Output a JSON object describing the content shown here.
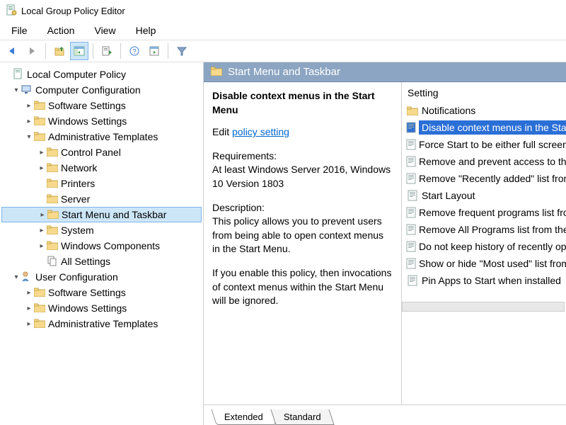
{
  "titlebar": {
    "title": "Local Group Policy Editor"
  },
  "menu": {
    "file": "File",
    "action": "Action",
    "view": "View",
    "help": "Help"
  },
  "tree": {
    "root": "Local Computer Policy",
    "cc": "Computer Configuration",
    "cc_sw": "Software Settings",
    "cc_win": "Windows Settings",
    "cc_admin": "Administrative Templates",
    "cc_cp": "Control Panel",
    "cc_net": "Network",
    "cc_prn": "Printers",
    "cc_srv": "Server",
    "cc_start": "Start Menu and Taskbar",
    "cc_sys": "System",
    "cc_wc": "Windows Components",
    "cc_all": "All Settings",
    "uc": "User Configuration",
    "uc_sw": "Software Settings",
    "uc_win": "Windows Settings",
    "uc_admin": "Administrative Templates"
  },
  "detail": {
    "header": "Start Menu and Taskbar",
    "policy_title": "Disable context menus in the Start Menu",
    "edit_prefix": "Edit ",
    "edit_link": "policy setting",
    "req_label": "Requirements:",
    "req_text": "At least Windows Server 2016, Windows 10 Version 1803",
    "desc_label": "Description:",
    "desc_text": "This policy allows you to prevent users from being able to open context menus in the Start Menu.",
    "desc_text2": "If you enable this policy, then invocations of context menus within the Start Menu will be ignored."
  },
  "list": {
    "column": "Setting",
    "items": [
      {
        "kind": "folder",
        "label": "Notifications"
      },
      {
        "kind": "policy",
        "label": "Disable context menus in the Start Menu",
        "selected": true
      },
      {
        "kind": "policy",
        "label": "Force Start to be either full screen or menu"
      },
      {
        "kind": "policy",
        "label": "Remove and prevent access to the Shut Down command"
      },
      {
        "kind": "policy",
        "label": "Remove \"Recently added\" list from Start Menu"
      },
      {
        "kind": "policy",
        "label": "Start Layout"
      },
      {
        "kind": "policy",
        "label": "Remove frequent programs list from the Start Menu"
      },
      {
        "kind": "policy",
        "label": "Remove All Programs list from the Start Menu"
      },
      {
        "kind": "policy",
        "label": "Do not keep history of recently opened documents"
      },
      {
        "kind": "policy",
        "label": "Show or hide \"Most used\" list from Start Menu"
      },
      {
        "kind": "policy",
        "label": "Pin Apps to Start when installed"
      }
    ]
  },
  "tabs": {
    "extended": "Extended",
    "standard": "Standard"
  }
}
